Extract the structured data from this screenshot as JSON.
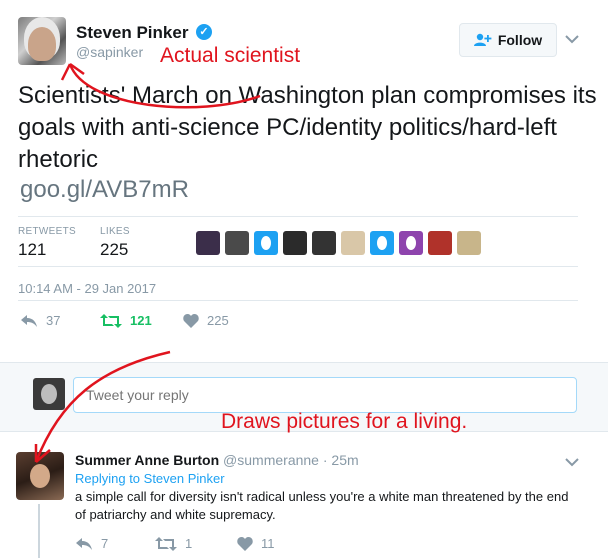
{
  "tweet": {
    "author_name": "Steven Pinker",
    "author_handle": "@sapinker",
    "follow_label": "Follow",
    "text": "Scientists' March on Washington plan compromises its goals with anti-science PC/identity politics/hard-left rhetoric",
    "link": "goo.gl/AVB7mR",
    "retweets_label": "RETWEETS",
    "retweets_count": "121",
    "likes_label": "LIKES",
    "likes_count": "225",
    "timestamp": "10:14 AM - 29 Jan 2017",
    "actions": {
      "reply_count": "37",
      "retweet_count": "121",
      "like_count": "225"
    }
  },
  "liker_avatars": [
    "#3b2e4a",
    "#4a4a4a",
    "#1da1f2",
    "#2b2b2b",
    "#333333",
    "#d9c7a8",
    "#1da1f2",
    "#8e44ad",
    "#b0322a",
    "#c8b58a"
  ],
  "reply_box": {
    "placeholder": "Tweet your reply"
  },
  "reply": {
    "author_name": "Summer Anne Burton",
    "author_handle": "@summeranne",
    "age": "· 25m",
    "replying_to": "Replying to Steven Pinker",
    "text": "a simple call for diversity isn't radical unless you're a white man threatened by the end of patriarchy and white supremacy.",
    "actions": {
      "reply_count": "7",
      "retweet_count": "1",
      "like_count": "11"
    }
  },
  "annotations": {
    "top": "Actual scientist",
    "bottom": "Draws pictures for a living."
  },
  "colors": {
    "accent_blue": "#1da1f2",
    "retweet_green": "#17bf63",
    "annotation_red": "#e0141e",
    "muted": "#8899a6"
  }
}
